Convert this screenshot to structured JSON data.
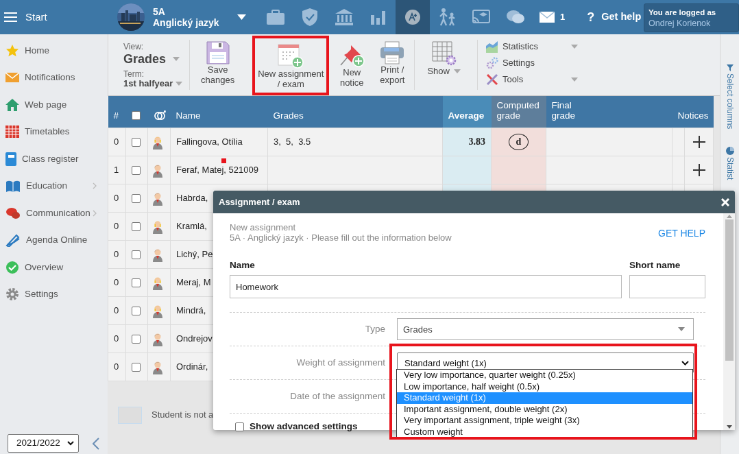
{
  "topbar": {
    "menu": "Start",
    "course": {
      "class": "5A",
      "subject": "Anglický jazyk"
    },
    "nav": [
      {
        "kind": "briefcase",
        "selected": false
      },
      {
        "kind": "shield",
        "selected": false
      },
      {
        "kind": "bank",
        "selected": false
      },
      {
        "kind": "chart",
        "selected": false
      },
      {
        "kind": "grade",
        "selected": true
      },
      {
        "kind": "walk",
        "selected": false
      },
      {
        "kind": "cast",
        "selected": false
      },
      {
        "kind": "chat",
        "selected": false
      }
    ],
    "messages": "1",
    "help": {
      "icon": "?",
      "label": "Get help"
    },
    "login": {
      "caption": "You are logged as",
      "user": "Ondrej Korienok"
    }
  },
  "sidebar": {
    "items": [
      {
        "kind": "star",
        "label": "Home",
        "submenu": false
      },
      {
        "kind": "mail",
        "label": "Notifications",
        "submenu": false
      },
      {
        "kind": "house",
        "label": "Web page",
        "submenu": false
      },
      {
        "kind": "timetable",
        "label": "Timetables",
        "submenu": false
      },
      {
        "kind": "notebook",
        "label": "Class register",
        "submenu": false
      },
      {
        "kind": "book",
        "label": "Education",
        "submenu": true
      },
      {
        "kind": "chat",
        "label": "Communication",
        "submenu": true
      },
      {
        "kind": "pen",
        "label": "Agenda Online",
        "submenu": false
      },
      {
        "kind": "check",
        "label": "Overview",
        "submenu": false
      },
      {
        "kind": "gear",
        "label": "Settings",
        "submenu": false
      }
    ],
    "year": "2021/2022"
  },
  "toolbar": {
    "view": {
      "caption": "View:",
      "value": "Grades"
    },
    "term": {
      "caption": "Term:",
      "value": "1st halfyear"
    },
    "buttons": [
      {
        "kind": "floppy",
        "label": "Save\nchanges",
        "highlighted": false,
        "dropdown": false
      },
      {
        "kind": "calendar",
        "label": "New assignment\n/ exam",
        "highlighted": true,
        "dropdown": false
      },
      {
        "kind": "pin",
        "label": "New\nnotice",
        "highlighted": false,
        "dropdown": false
      },
      {
        "kind": "printer",
        "label": "Print /\nexport",
        "highlighted": false,
        "dropdown": false
      },
      {
        "kind": "grid",
        "label": "Show",
        "highlighted": false,
        "dropdown": true
      }
    ],
    "menu": [
      {
        "kind": "stats",
        "label": "Statistics",
        "dropdown": true
      },
      {
        "kind": "gears",
        "label": "Settings",
        "dropdown": false
      },
      {
        "kind": "tools",
        "label": "Tools",
        "dropdown": true
      }
    ]
  },
  "table": {
    "columns": [
      {
        "kind": "number",
        "label": "#"
      },
      {
        "kind": "checkbox",
        "checked": false
      },
      {
        "kind": "gender"
      },
      {
        "kind": "name",
        "label": "Name"
      },
      {
        "kind": "grades",
        "label": "Grades"
      },
      {
        "kind": "average",
        "label": "Average"
      },
      {
        "kind": "computed",
        "label": "Computed\ngrade"
      },
      {
        "kind": "final",
        "label": "Final\ngrade"
      },
      {
        "kind": "notices",
        "label": "Notices"
      }
    ],
    "rows": [
      {
        "number": "0",
        "checked": false,
        "kind": "female",
        "name": "Fallingova, Otília",
        "flagged": false,
        "grades": "3,  5,  3.5",
        "average": "3.83",
        "computed": "d",
        "notice": true
      },
      {
        "number": "1",
        "checked": false,
        "kind": "male",
        "name": "Feraf, Matej, 521009",
        "flagged": true,
        "notice": true
      },
      {
        "number": "0",
        "checked": false,
        "kind": "male",
        "name": "Habrda,",
        "flagged": false
      },
      {
        "number": "0",
        "checked": false,
        "kind": "female",
        "name": "Kramlá,",
        "flagged": false
      },
      {
        "number": "0",
        "checked": false,
        "kind": "male",
        "name": "Lichý, Pe",
        "flagged": false
      },
      {
        "number": "0",
        "checked": false,
        "kind": "female",
        "name": "Meraj, M",
        "flagged": false
      },
      {
        "number": "0",
        "checked": false,
        "kind": "female",
        "name": "Mindrá,",
        "flagged": false
      },
      {
        "number": "0",
        "checked": false,
        "kind": "male",
        "name": "Ondrejov",
        "flagged": false
      },
      {
        "number": "0",
        "checked": false,
        "kind": "male",
        "name": "Ordinár,",
        "flagged": false
      }
    ]
  },
  "side_tabs": [
    {
      "kind": "filter",
      "label": "Select columns"
    },
    {
      "kind": "pie",
      "label": "Statist"
    }
  ],
  "legend": "Student is not a",
  "dialog": {
    "title": "Assignment / exam",
    "subtitle": "New assignment",
    "context": "5A · Anglický jazyk · Please fill out the information below",
    "help_link": "GET HELP",
    "name": {
      "label": "Name",
      "value": "Homework"
    },
    "short_name": {
      "label": "Short name"
    },
    "type": {
      "label": "Type",
      "value": "Grades"
    },
    "weight": {
      "label": "Weight of assignment",
      "value": "Standard weight (1x)",
      "expanded": true,
      "highlighted": true,
      "options": [
        {
          "label": "Very low importance, quarter weight (0.25x)",
          "selected": false
        },
        {
          "label": "Low importance, half weight (0.5x)",
          "selected": false
        },
        {
          "label": "Standard weight (1x)",
          "selected": true
        },
        {
          "label": "Important assignment, double weight (2x)",
          "selected": false
        },
        {
          "label": "Very important assignment, triple weight (3x)",
          "selected": false
        },
        {
          "label": "Custom weight",
          "selected": false
        }
      ]
    },
    "date": {
      "label": "Date of the assignment"
    },
    "advanced": {
      "label": "Show advanced settings",
      "checked": false
    }
  }
}
